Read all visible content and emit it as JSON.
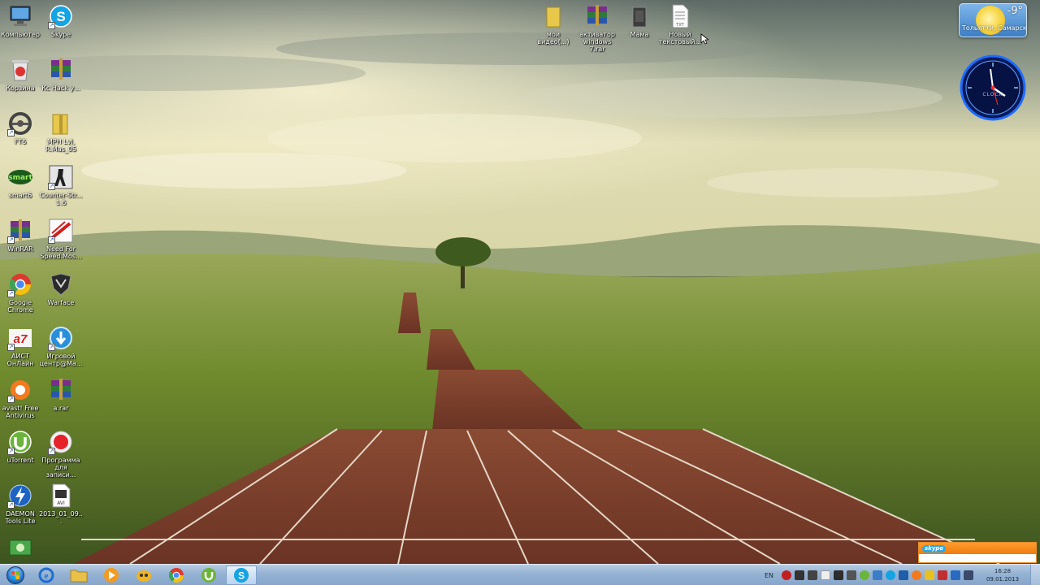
{
  "desktop": {
    "icons_left": [
      {
        "label": "Компьютер",
        "icon": "computer-icon"
      },
      {
        "label": "Skype",
        "icon": "skype-icon"
      },
      {
        "label": "Корзина",
        "icon": "recycle-bin-icon"
      },
      {
        "label": "Кс Hack у...",
        "icon": "winrar-archive-icon"
      },
      {
        "label": "FT6",
        "icon": "steering-wheel-icon"
      },
      {
        "label": "MPH Lvl. R.Mas_05",
        "icon": "archive-folder-icon"
      },
      {
        "label": "smart6",
        "icon": "smart-logo-icon"
      },
      {
        "label": "Counter-Str... 1.6",
        "icon": "counter-strike-icon"
      },
      {
        "label": "WinRAR",
        "icon": "winrar-icon"
      },
      {
        "label": "Need For Speed.Mos...",
        "icon": "nfs-icon"
      },
      {
        "label": "Google Chrome",
        "icon": "chrome-icon"
      },
      {
        "label": "Warface",
        "icon": "warface-icon"
      },
      {
        "label": "АИСТ ОнЛайн",
        "icon": "aist-icon"
      },
      {
        "label": "Игровой центр@Ma...",
        "icon": "game-center-icon"
      },
      {
        "label": "avast! Free Antivirus",
        "icon": "avast-icon"
      },
      {
        "label": "a.rar",
        "icon": "rar-archive-icon"
      },
      {
        "label": "uTorrent",
        "icon": "utorrent-icon"
      },
      {
        "label": "Программа для записи...",
        "icon": "record-icon"
      },
      {
        "label": "DAEMON Tools Lite",
        "icon": "daemon-tools-icon"
      },
      {
        "label": "2013_01_09...",
        "icon": "avi-file-icon"
      },
      {
        "label": "",
        "icon": "money-icon"
      }
    ],
    "icons_top": [
      {
        "label": "мои видео(...)",
        "icon": "folder-icon"
      },
      {
        "label": "активатор windows 7.rar",
        "icon": "winrar-archive-icon"
      },
      {
        "label": "Мама",
        "icon": "dark-folder-icon"
      },
      {
        "label": "Новый текстовый...",
        "icon": "text-file-icon"
      }
    ]
  },
  "gadgets": {
    "weather": {
      "temp": "-9°",
      "city": "Тольятти, Самарск..."
    },
    "clock": {
      "label": "CLOCK",
      "time": "16:28"
    }
  },
  "skype_popup": {
    "brand": "skype"
  },
  "taskbar": {
    "pinned": [
      {
        "name": "ie-icon"
      },
      {
        "name": "explorer-icon"
      },
      {
        "name": "media-player-icon"
      },
      {
        "name": "game-icon"
      },
      {
        "name": "chrome-icon"
      },
      {
        "name": "utorrent-icon"
      },
      {
        "name": "skype-icon",
        "active": true
      }
    ],
    "language": "EN",
    "clock_time": "16:28",
    "clock_date": "09.01.2013"
  },
  "colors": {
    "taskbar_top": "#b6cbe2",
    "skype_orange": "#f07d11",
    "sky": "#c9c3a0",
    "grass": "#7f9238",
    "track": "#7a3b28"
  }
}
